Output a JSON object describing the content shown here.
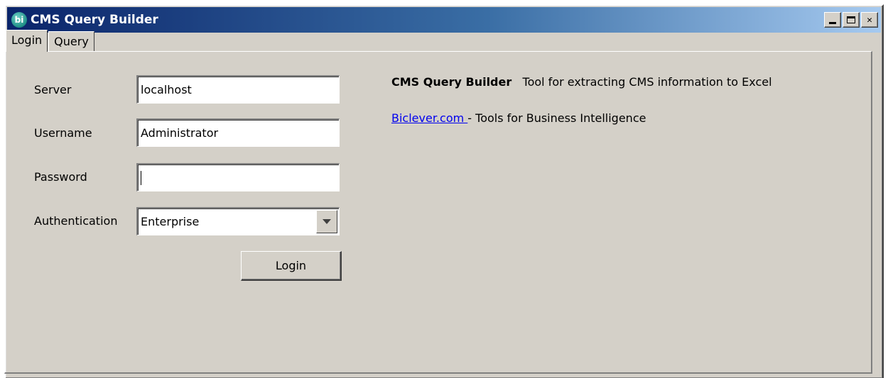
{
  "window": {
    "title": "CMS Query Builder",
    "icon_text": "bi"
  },
  "tabs": [
    {
      "label": "Login",
      "active": true
    },
    {
      "label": "Query",
      "active": false
    }
  ],
  "form": {
    "server_label": "Server",
    "server_value": "localhost",
    "username_label": "Username",
    "username_value": "Administrator",
    "password_label": "Password",
    "password_value": "",
    "auth_label": "Authentication",
    "auth_value": "Enterprise",
    "login_button": "Login"
  },
  "info": {
    "product_name": "CMS Query Builder",
    "product_desc": "Tool for extracting CMS information to Excel",
    "link_text": "Biclever.com ",
    "link_desc": "- Tools for Business Intelligence"
  },
  "colors": {
    "titlebar_start": "#0a246a",
    "titlebar_end": "#a6caf0",
    "face": "#d4d0c8",
    "link": "#0000ee"
  }
}
